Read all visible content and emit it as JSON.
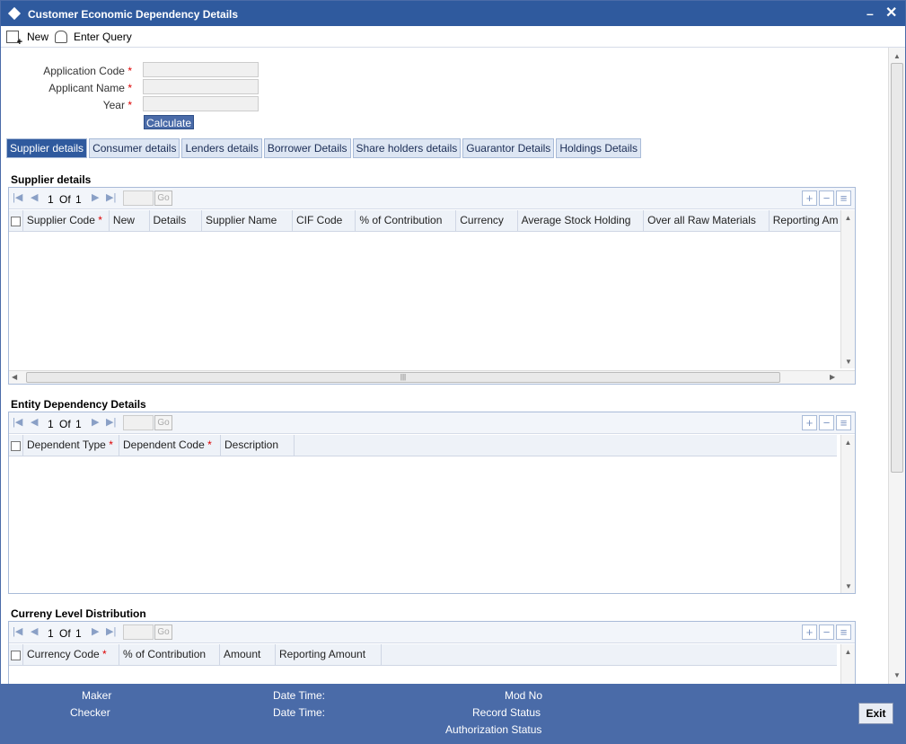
{
  "window": {
    "title": "Customer Economic Dependency Details",
    "minimize": "–",
    "close": "✕"
  },
  "toolbar": {
    "new_label": "New",
    "enter_query_label": "Enter Query"
  },
  "form": {
    "application_code_label": "Application Code",
    "applicant_name_label": "Applicant Name",
    "year_label": "Year",
    "required_mark": "*",
    "calculate_label": "Calculate"
  },
  "tabs": [
    "Supplier details",
    "Consumer details",
    "Lenders details",
    "Borrower Details",
    "Share holders details",
    "Guarantor Details",
    "Holdings Details"
  ],
  "supplier": {
    "title": "Supplier details",
    "pager": {
      "current": "1",
      "of": "Of",
      "total": "1",
      "go": "Go"
    },
    "columns": [
      "Supplier Code",
      "New",
      "Details",
      "Supplier Name",
      "CIF Code",
      "% of Contribution",
      "Currency",
      "Average Stock Holding",
      "Over all Raw Materials",
      "Reporting Am"
    ]
  },
  "entity": {
    "title": "Entity Dependency Details",
    "pager": {
      "current": "1",
      "of": "Of",
      "total": "1",
      "go": "Go"
    },
    "columns": [
      "Dependent Type",
      "Dependent Code",
      "Description"
    ]
  },
  "currency": {
    "title": "Curreny Level Distribution",
    "pager": {
      "current": "1",
      "of": "Of",
      "total": "1",
      "go": "Go"
    },
    "columns": [
      "Currency Code",
      "% of Contribution",
      "Amount",
      "Reporting Amount"
    ]
  },
  "footer": {
    "maker": "Maker",
    "checker": "Checker",
    "date_time_1": "Date Time:",
    "date_time_2": "Date Time:",
    "mod_no": "Mod No",
    "record_status": "Record Status",
    "authorization_status": "Authorization Status",
    "exit": "Exit"
  }
}
